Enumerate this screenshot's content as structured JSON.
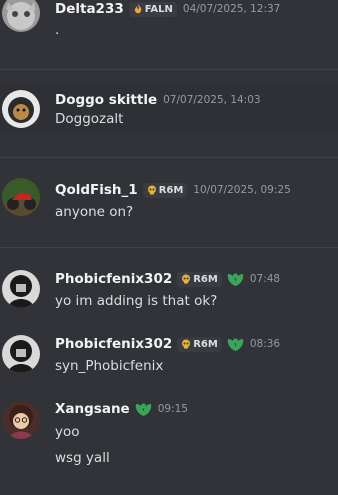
{
  "messages": [
    {
      "username": "Delta233",
      "tag": "FALN",
      "tag_icon": "flame-icon",
      "timestamp": "04/07/2025, 12:37",
      "lines": [
        "."
      ]
    },
    {
      "username": "Doggo skittle",
      "timestamp": "07/07/2025, 14:03",
      "lines": [
        "Doggozalt"
      ]
    },
    {
      "username": "QoldFish_1",
      "tag": "R6M",
      "tag_icon": "skull-icon",
      "timestamp": "10/07/2025, 09:25",
      "lines": [
        "anyone on?"
      ]
    },
    {
      "username": "Phobicfenix302",
      "tag": "R6M",
      "tag_icon": "skull-icon",
      "badge": "leaf-icon",
      "timestamp": "07:48",
      "lines": [
        "yo im adding is that ok?"
      ]
    },
    {
      "username": "Phobicfenix302",
      "tag": "R6M",
      "tag_icon": "skull-icon",
      "badge": "leaf-icon",
      "timestamp": "08:36",
      "lines": [
        "syn_Phobicfenix"
      ]
    },
    {
      "username": "Xangsane",
      "badge": "leaf-icon",
      "timestamp": "09:15",
      "lines": [
        "yoo",
        "wsg yall"
      ]
    }
  ],
  "colors": {
    "background": "#313338",
    "highlight": "#2e3035",
    "username": "#f2f3f5",
    "text": "#dbdee1",
    "timestamp": "#949ba4",
    "leaf": "#3ba55c",
    "tag_bg": "#3a3c42"
  }
}
